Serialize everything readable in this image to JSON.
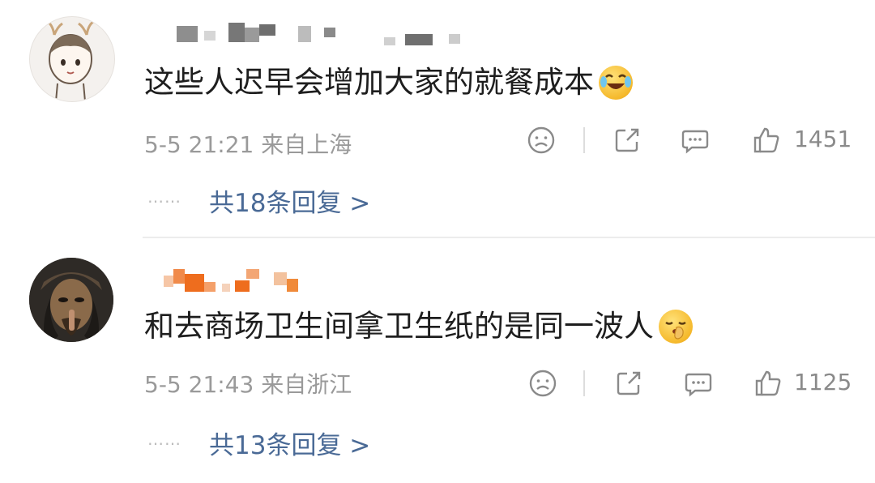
{
  "comments": [
    {
      "text": "这些人迟早会增加大家的就餐成本",
      "emoji": "laughing-crying-emoji",
      "meta": "5-5 21:21 来自上海",
      "likes": "1451",
      "replies": "共18条回复 >",
      "dots": "……"
    },
    {
      "text": "和去商场卫生间拿卫生纸的是同一波人",
      "emoji": "shush-emoji",
      "meta": "5-5 21:43 来自浙江",
      "likes": "1125",
      "replies": "共13条回复 >",
      "dots": "……"
    }
  ],
  "icons": {
    "dislike": "frown-face-icon",
    "share": "share-icon",
    "comment": "comment-bubble-icon",
    "like": "thumbs-up-icon"
  },
  "colors": {
    "reply_link": "#4a6a96",
    "meta": "#9a9a9a",
    "icon": "#8a8a8a"
  }
}
